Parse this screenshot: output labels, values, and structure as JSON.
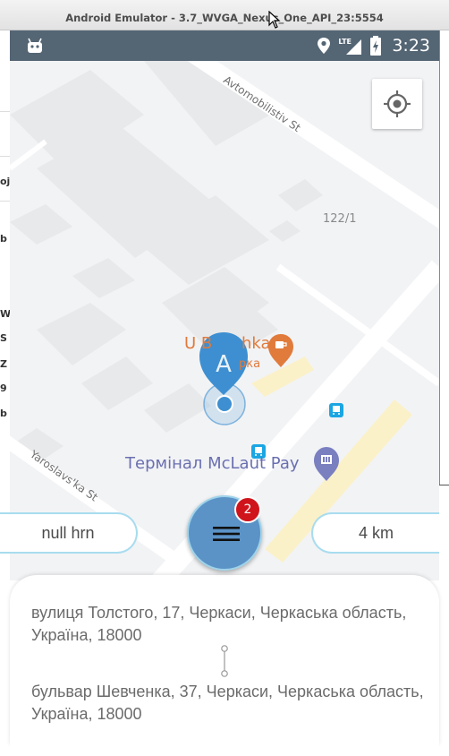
{
  "window": {
    "title": "Android Emulator - 3.7_WVGA_Nexus_One_API_23:5554"
  },
  "background_desktop": {
    "left_fragments": [
      "oj",
      "b",
      "W",
      "S",
      "Z",
      "9",
      "b"
    ]
  },
  "status_bar": {
    "network": "LTE",
    "time": "3:23"
  },
  "map": {
    "streets": [
      "Avtomobilistiv St",
      "Yaroslavs'ka St"
    ],
    "house_number": "122/1",
    "pois": [
      {
        "name": "U Babka",
        "subtitle": "Кав'ярня",
        "visible_label": "U B",
        "visible_tail": "hka",
        "visible_sub": "рка",
        "color": "#e07b3c"
      },
      {
        "name": "Термінал McLaut Pay",
        "color": "#6a6fb0"
      }
    ],
    "marker_letter": "A",
    "accent_blue": "#3d8fd1",
    "icons": [
      "my-location-icon",
      "cafe-icon",
      "bus-stop-icon",
      "bank-icon"
    ]
  },
  "controls": {
    "price": "null hrn",
    "distance": "4 km",
    "menu_badge": "2"
  },
  "route": {
    "from": "вулиця Толстого, 17, Черкаси, Черкаська область, Україна, 18000",
    "to": "бульвар Шевченка, 37, Черкаси, Черкаська область, Україна, 18000"
  }
}
